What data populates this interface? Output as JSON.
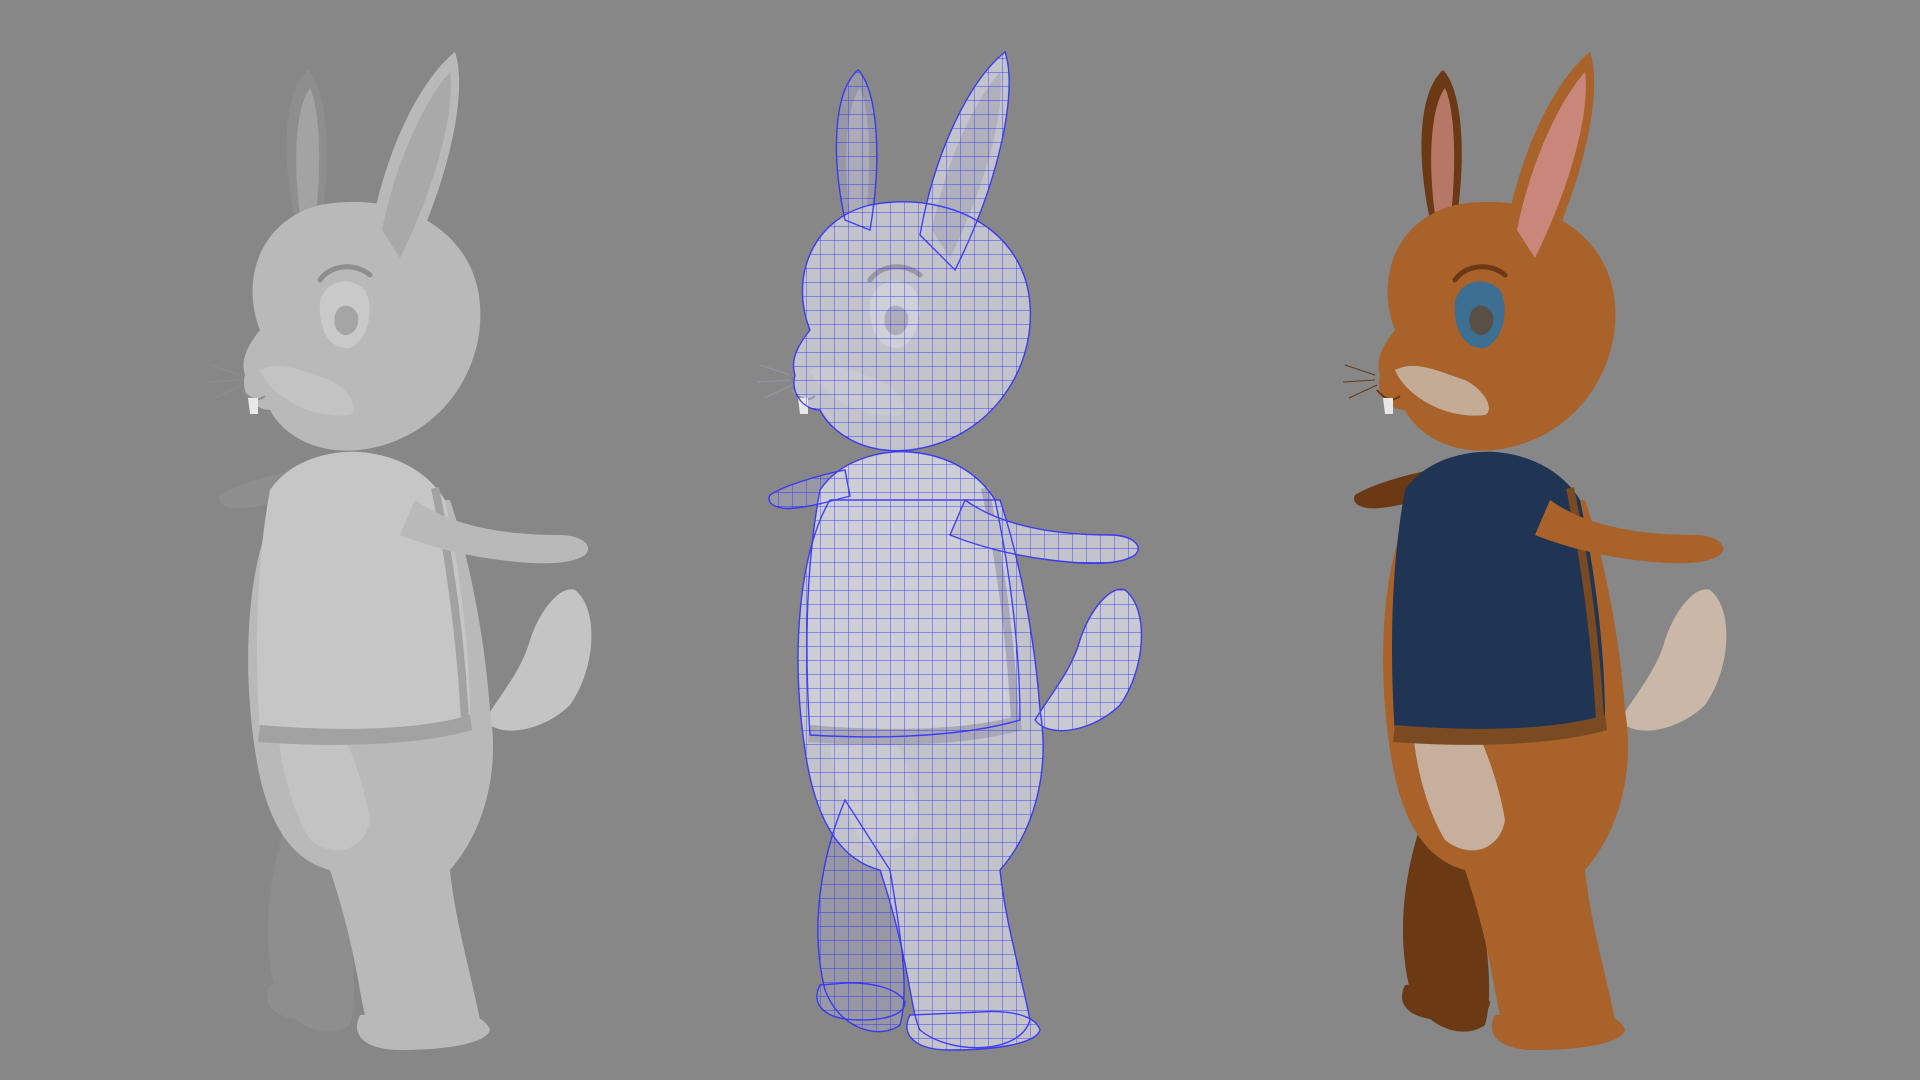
{
  "viewport": {
    "background": "#878787"
  },
  "renders": [
    {
      "id": "clay",
      "shading": "smooth-shaded",
      "palette": {
        "fur": "#b9b9b9",
        "fur_dark": "#8e8e8e",
        "belly": "#c4c4c4",
        "ear_inner": "#a9a9a9",
        "vest": "#c6c6c6",
        "vest_dark": "#9a9a9a",
        "eye": "#c9c9c9",
        "trim": "#a2a2a2"
      }
    },
    {
      "id": "wireframe",
      "shading": "wireframe-on-shaded",
      "palette": {
        "fur": "#c3c3cb",
        "fur_dark": "#9797a6",
        "belly": "#cacad2",
        "ear_inner": "#b1b1bd",
        "vest": "#cdcdd5",
        "vest_dark": "#a0a0ae",
        "eye": "#d0d0d8",
        "trim": "#a8a8b6"
      },
      "wire_color": "#2a2aff"
    },
    {
      "id": "textured",
      "shading": "textured",
      "palette": {
        "fur": "#a8622a",
        "fur_dark": "#6b3a14",
        "belly": "#c9b8a8",
        "ear_inner": "#c9877c",
        "vest": "#1f3553",
        "vest_dark": "#142338",
        "eye": "#3c6f92",
        "trim": "#7a4a22"
      }
    }
  ]
}
